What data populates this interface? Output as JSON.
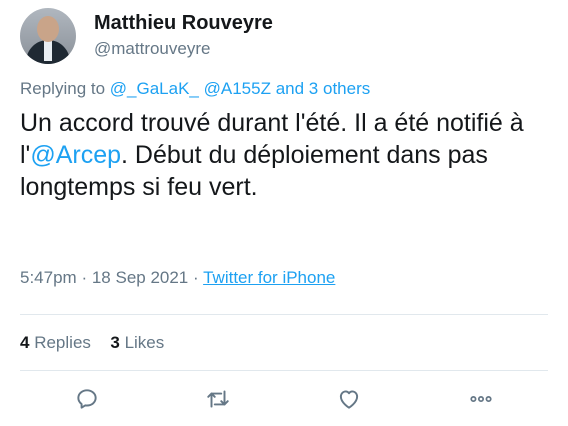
{
  "user": {
    "name": "Matthieu Rouveyre",
    "handle": "@mattrouveyre"
  },
  "replying": {
    "prefix": "Replying to",
    "mention1": "@_GaLaK_",
    "mention2": "@A155Z",
    "others": "and 3 others"
  },
  "tweet": {
    "text_part1": "Un accord trouvé durant l'été. Il a été notifié à l'",
    "mention": "@Arcep",
    "text_part2": ". Début du déploiement dans pas longtemps si feu vert."
  },
  "meta": {
    "time": "5:47pm",
    "date": "18 Sep 2021",
    "separator": "·",
    "source": "Twitter for iPhone"
  },
  "stats": {
    "replies_count": "4",
    "replies_label": "Replies",
    "likes_count": "3",
    "likes_label": "Likes"
  },
  "icons": {
    "reply": "reply-icon",
    "retweet": "retweet-icon",
    "like": "heart-icon",
    "more": "more-icon"
  },
  "colors": {
    "accent": "#1da1f2",
    "muted": "#657786",
    "text": "#14171a",
    "divider": "#e1e8ed"
  }
}
